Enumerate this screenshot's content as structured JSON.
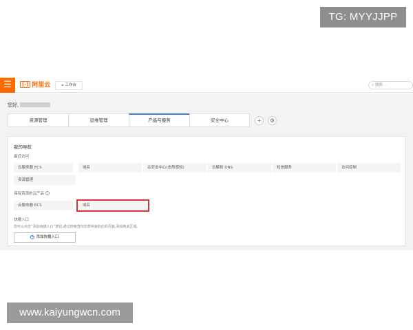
{
  "watermarks": {
    "top": "TG: MYYJJPP",
    "bottom": "www.kaiyungwcn.com"
  },
  "topbar": {
    "menu_icon": "☰",
    "logo_mark": "[-]",
    "logo_text": "阿里云",
    "workbench_label": "工作台",
    "search_placeholder": "搜索..."
  },
  "greeting": "您好,",
  "tabs": [
    {
      "label": "资源管理"
    },
    {
      "label": "运维管理"
    },
    {
      "label": "产品与服务",
      "active": true
    },
    {
      "label": "安全中心"
    }
  ],
  "tab_actions": {
    "add": "+",
    "settings": "⚙"
  },
  "nav": {
    "title": "我的导航",
    "recent_title": "最近访问",
    "recent_items": [
      "云服务器 ECS",
      "域名",
      "云安全中心(态势感知)",
      "云解析 DNS",
      "短信服务",
      "访问控制",
      "资源管理"
    ],
    "owned_title": "保有资源的云产品",
    "owned_items": [
      "云服务器 ECS",
      "域名"
    ],
    "quick_title": "快捷入口",
    "quick_desc": "您可以点击“添加快捷入口”按钮,通过搜索查找您想快速前往的页面,添加到此区域。",
    "add_button": "添加快捷入口"
  },
  "colors": {
    "brand": "#ff6a00",
    "highlight": "#d9333a",
    "accent": "#3a7bd5"
  }
}
